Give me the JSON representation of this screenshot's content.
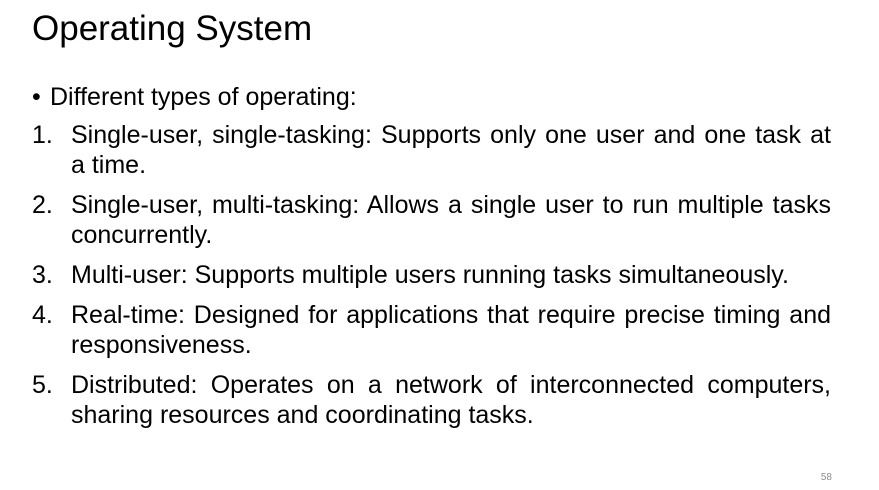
{
  "slide": {
    "title": "Operating System",
    "intro_bullet": "•",
    "intro_text": "Different types of operating:",
    "items": [
      {
        "number": "1.",
        "text": "Single-user, single-tasking: Supports only one user and one task at a time."
      },
      {
        "number": "2.",
        "text": "Single-user, multi-tasking: Allows a single user to run multiple tasks concurrently."
      },
      {
        "number": "3.",
        "text": "Multi-user: Supports multiple users running tasks simultaneously."
      },
      {
        "number": "4.",
        "text": "Real-time: Designed for applications that require precise timing and responsiveness."
      },
      {
        "number": "5.",
        "text": "Distributed: Operates on a network of interconnected computers, sharing resources and coordinating tasks."
      }
    ],
    "page_number": "58"
  }
}
